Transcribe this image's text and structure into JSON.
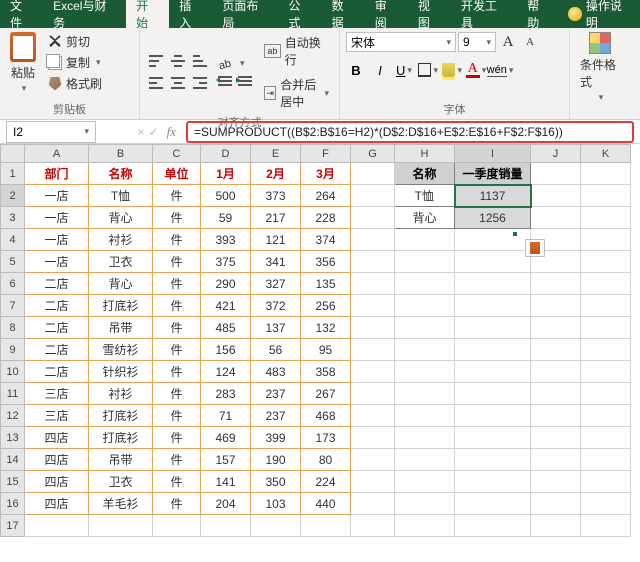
{
  "tabs": {
    "file": "文件",
    "extra": "Excel与财务",
    "home": "开始",
    "insert": "插入",
    "layout": "页面布局",
    "formulas": "公式",
    "data": "数据",
    "review": "审阅",
    "view": "视图",
    "dev": "开发工具",
    "help": "帮助",
    "tell": "操作说明"
  },
  "ribbon": {
    "clipboard": {
      "paste": "粘贴",
      "cut": "剪切",
      "copy": "复制",
      "painter": "格式刷",
      "group": "剪贴板"
    },
    "alignment": {
      "wrap": "自动换行",
      "merge": "合并后居中",
      "group": "对齐方式"
    },
    "font": {
      "name": "宋体",
      "size": "9",
      "group": "字体"
    },
    "cond": {
      "label": "条件格式"
    }
  },
  "namebox": "I2",
  "formula": "=SUMPRODUCT((B$2:B$16=H2)*(D$2:D$16+E$2:E$16+F$2:F$16))",
  "columns": [
    "A",
    "B",
    "C",
    "D",
    "E",
    "F",
    "G",
    "H",
    "I",
    "J",
    "K"
  ],
  "headers": {
    "dept": "部门",
    "name": "名称",
    "unit": "单位",
    "m1": "1月",
    "m2": "2月",
    "m3": "3月",
    "name2": "名称",
    "q1": "一季度销量"
  },
  "rows": [
    {
      "r": 2,
      "a": "一店",
      "b": "T恤",
      "c": "件",
      "d": "500",
      "e": "373",
      "f": "264",
      "h": "T恤",
      "i": "1137"
    },
    {
      "r": 3,
      "a": "一店",
      "b": "背心",
      "c": "件",
      "d": "59",
      "e": "217",
      "f": "228",
      "h": "背心",
      "i": "1256"
    },
    {
      "r": 4,
      "a": "一店",
      "b": "衬衫",
      "c": "件",
      "d": "393",
      "e": "121",
      "f": "374"
    },
    {
      "r": 5,
      "a": "一店",
      "b": "卫衣",
      "c": "件",
      "d": "375",
      "e": "341",
      "f": "356"
    },
    {
      "r": 6,
      "a": "二店",
      "b": "背心",
      "c": "件",
      "d": "290",
      "e": "327",
      "f": "135"
    },
    {
      "r": 7,
      "a": "二店",
      "b": "打底衫",
      "c": "件",
      "d": "421",
      "e": "372",
      "f": "256"
    },
    {
      "r": 8,
      "a": "二店",
      "b": "吊带",
      "c": "件",
      "d": "485",
      "e": "137",
      "f": "132"
    },
    {
      "r": 9,
      "a": "二店",
      "b": "雪纺衫",
      "c": "件",
      "d": "156",
      "e": "56",
      "f": "95"
    },
    {
      "r": 10,
      "a": "二店",
      "b": "针织衫",
      "c": "件",
      "d": "124",
      "e": "483",
      "f": "358"
    },
    {
      "r": 11,
      "a": "三店",
      "b": "衬衫",
      "c": "件",
      "d": "283",
      "e": "237",
      "f": "267"
    },
    {
      "r": 12,
      "a": "三店",
      "b": "打底衫",
      "c": "件",
      "d": "71",
      "e": "237",
      "f": "468"
    },
    {
      "r": 13,
      "a": "四店",
      "b": "打底衫",
      "c": "件",
      "d": "469",
      "e": "399",
      "f": "173"
    },
    {
      "r": 14,
      "a": "四店",
      "b": "吊带",
      "c": "件",
      "d": "157",
      "e": "190",
      "f": "80"
    },
    {
      "r": 15,
      "a": "四店",
      "b": "卫衣",
      "c": "件",
      "d": "141",
      "e": "350",
      "f": "224"
    },
    {
      "r": 16,
      "a": "四店",
      "b": "羊毛衫",
      "c": "件",
      "d": "204",
      "e": "103",
      "f": "440"
    }
  ]
}
